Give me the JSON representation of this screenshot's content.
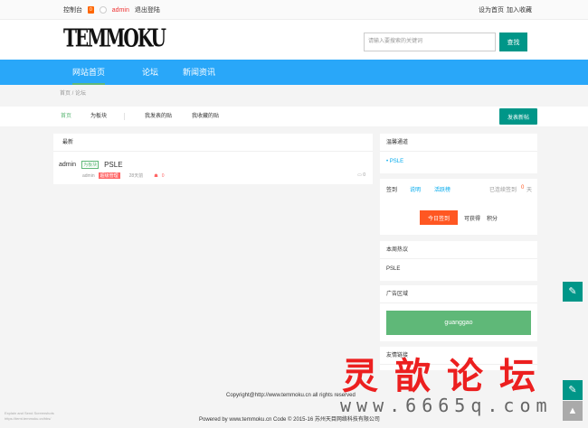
{
  "topbar": {
    "console": "控制台",
    "badge": "0",
    "username": "admin",
    "logout": "退出登陆",
    "set_home": "设为首页",
    "add_favorite": "加入收藏"
  },
  "header": {
    "logo": "TEMMOKU",
    "search_placeholder": "请输入要搜索的关键词",
    "search_button": "查找"
  },
  "nav": {
    "items": [
      {
        "label": "网站首页"
      },
      {
        "label": "论坛"
      },
      {
        "label": "新闻资讯"
      }
    ]
  },
  "breadcrumb": {
    "text": "首页 / 论坛"
  },
  "subnav": {
    "items": [
      {
        "label": "首页"
      },
      {
        "label": "为板块"
      },
      {
        "label": "我发表的贴"
      },
      {
        "label": "我收藏的贴"
      }
    ],
    "post_button": "发表新帖"
  },
  "main": {
    "header": "最新",
    "post": {
      "author": "admin",
      "tag": "为板块",
      "title": "PSLE",
      "byline": "admin",
      "vip": "超级管理",
      "time": "28天前",
      "count": "0",
      "replies": "0"
    }
  },
  "sidebar": {
    "warm": {
      "title": "温馨通道",
      "item": "• PSLE"
    },
    "sign": {
      "label": "签到",
      "explain": "说明",
      "activity": "活跃榜",
      "status": "已连续签到",
      "days": "0",
      "days_unit": "天",
      "sign_button": "今日签到",
      "earn": "可获得",
      "points": "积分"
    },
    "hot": {
      "title": "本周热议",
      "item": "PSLE"
    },
    "ad": {
      "title": "广告区域",
      "box": "guanggao"
    },
    "links": {
      "title": "友情链接"
    }
  },
  "footer": {
    "copyright": "Copyright@http://www.temmoku.cn all rights reserved",
    "powered": "Powered by www.temmoku.cn Code © 2015-16 苏州天目网络科技有限公司"
  },
  "corner_note": {
    "line1": "Explain and Send Screenshots",
    "line2": "https://temt.temmoku.cn/bbs/"
  },
  "overlay": {
    "cn": "灵歆论坛",
    "url": "www.6665q.com"
  },
  "float_icons": [
    "pencil-icon",
    "pencil-icon",
    "rocket-icon"
  ]
}
